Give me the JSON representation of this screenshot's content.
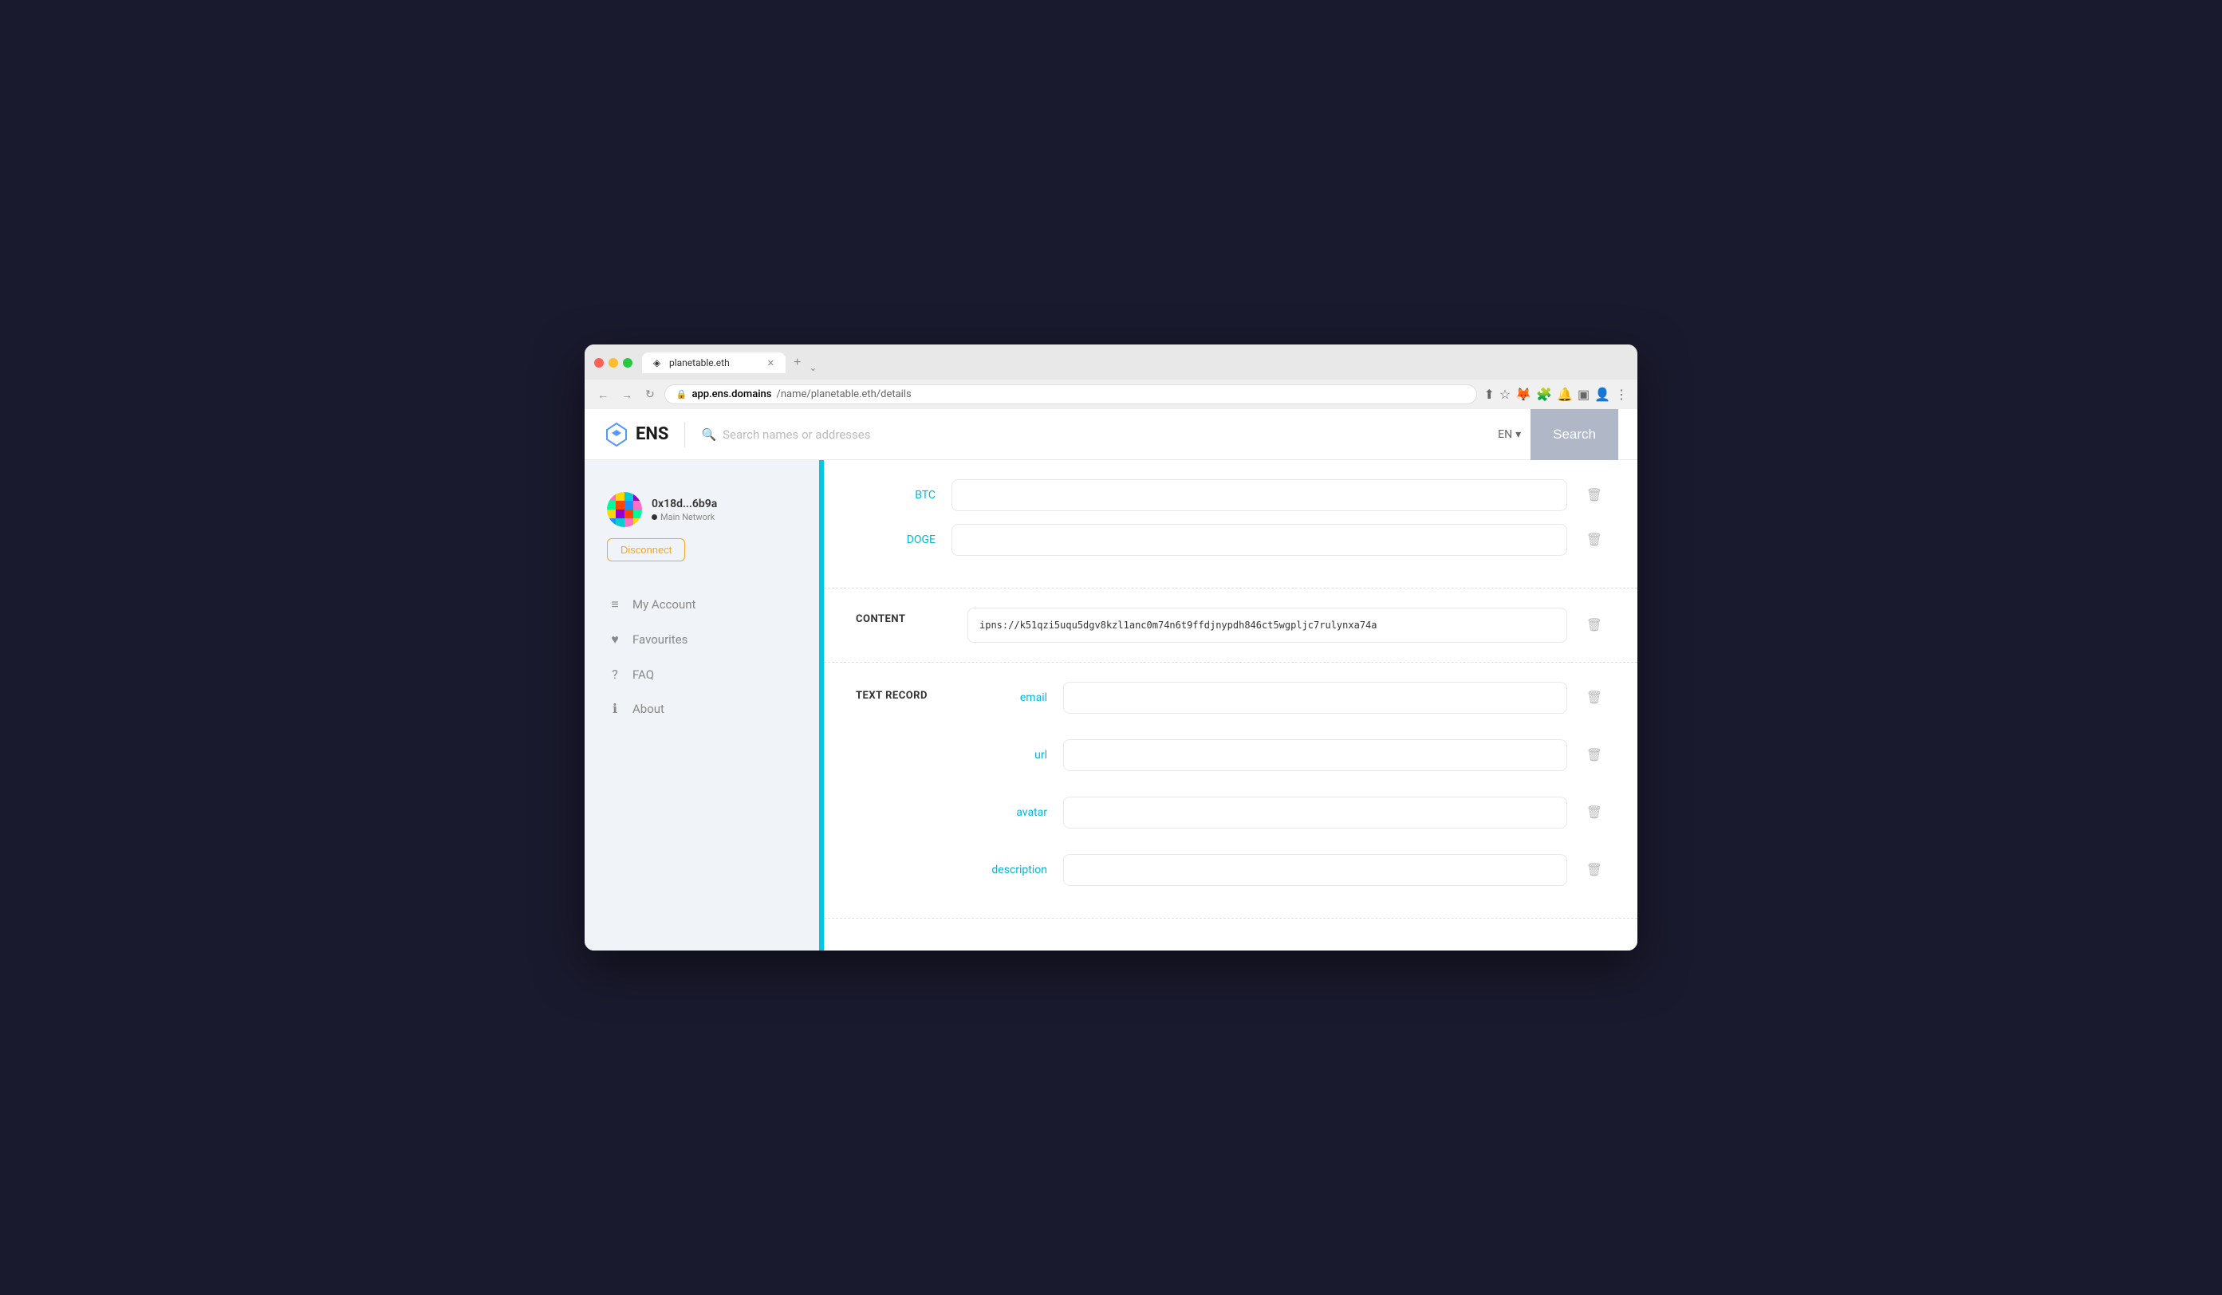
{
  "browser": {
    "tab_title": "planetable.eth",
    "tab_favicon": "◈",
    "url_domain": "app.ens.domains",
    "url_path": "/name/planetable.eth/details",
    "new_tab_label": "+",
    "expand_label": "⌄"
  },
  "header": {
    "logo_text": "ENS",
    "search_placeholder": "Search names or addresses",
    "search_icon": "🔍",
    "lang": "EN",
    "lang_chevron": "▾",
    "search_btn": "Search"
  },
  "sidebar": {
    "account_address": "0x18d...6b9a",
    "network": "Main Network",
    "disconnect_label": "Disconnect",
    "nav_items": [
      {
        "icon": "≡",
        "label": "My Account"
      },
      {
        "icon": "♥",
        "label": "Favourites"
      },
      {
        "icon": "?",
        "label": "FAQ"
      },
      {
        "icon": "ℹ",
        "label": "About"
      }
    ]
  },
  "content": {
    "coin_section": {
      "coins": [
        {
          "label": "BTC",
          "value": ""
        },
        {
          "label": "DOGE",
          "value": ""
        }
      ]
    },
    "content_section": {
      "header": "CONTENT",
      "value": "ipns://k51qzi5uqu5dgv8kzl1anc0m74n6t9ffdjnypdh846ct5wgpljc7rulynxa74a"
    },
    "text_record_section": {
      "header": "TEXT RECORD",
      "fields": [
        {
          "label": "email",
          "value": ""
        },
        {
          "label": "url",
          "value": ""
        },
        {
          "label": "avatar",
          "value": ""
        },
        {
          "label": "description",
          "value": ""
        }
      ]
    }
  }
}
